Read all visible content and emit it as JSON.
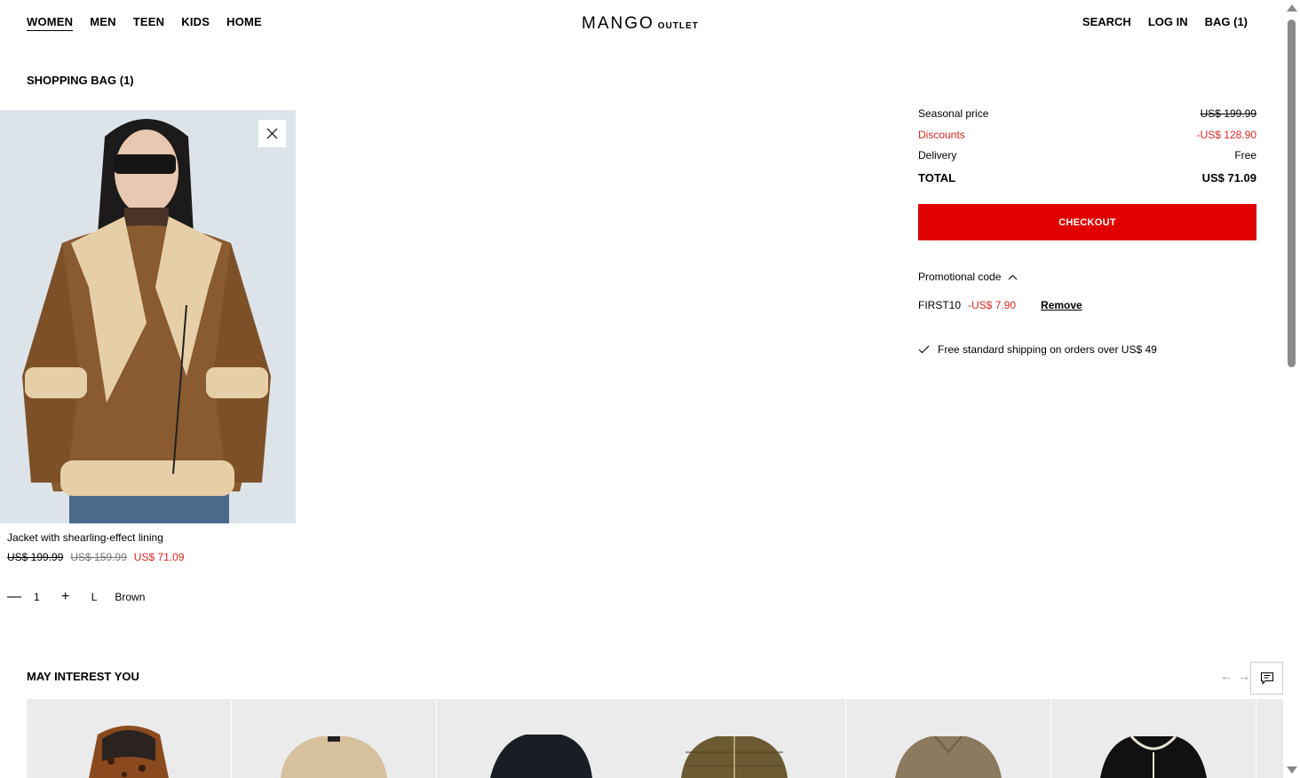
{
  "header": {
    "nav_left": [
      "WOMEN",
      "MEN",
      "TEEN",
      "KIDS",
      "HOME"
    ],
    "logo_brand": "MANGO",
    "logo_sub": "OUTLET",
    "nav_right": [
      "SEARCH",
      "LOG IN",
      "BAG (1)"
    ]
  },
  "bag": {
    "title": "SHOPPING BAG (1)",
    "item": {
      "name": "Jacket with shearling-effect lining",
      "price_original": "US$ 199.99",
      "price_seasonal": "US$ 159.99",
      "price_final": "US$ 71.09",
      "quantity": "1",
      "size": "L",
      "color": "Brown"
    }
  },
  "summary": {
    "rows": [
      {
        "label": "Seasonal price",
        "value": "US$ 199.99"
      },
      {
        "label": "Discounts",
        "value": "-US$ 128.90"
      },
      {
        "label": "Delivery",
        "value": "Free"
      }
    ],
    "total_label": "TOTAL",
    "total_value": "US$ 71.09",
    "checkout_label": "CHECKOUT",
    "promo_label": "Promotional code",
    "promo_code": "FIRST10",
    "promo_amount": "-US$ 7.90",
    "promo_remove": "Remove",
    "shipping_note": "Free standard shipping on orders over US$ 49"
  },
  "recommendations": {
    "title": "MAY INTEREST YOU"
  },
  "colors": {
    "accent": "#e00000",
    "discount": "#e0261f"
  }
}
